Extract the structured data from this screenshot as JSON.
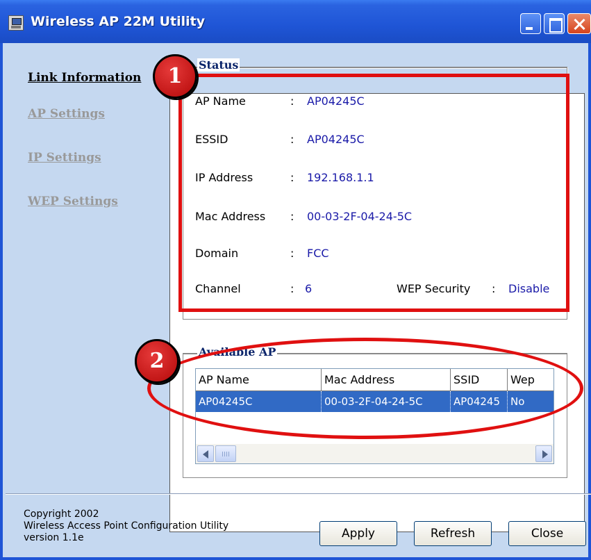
{
  "window": {
    "title": "Wireless AP 22M Utility",
    "icon": "app-window-icon"
  },
  "sidebar": {
    "items": [
      {
        "label": "Link Information",
        "active": true
      },
      {
        "label": "AP Settings",
        "active": false
      },
      {
        "label": "IP Settings",
        "active": false
      },
      {
        "label": "WEP Settings",
        "active": false
      }
    ]
  },
  "status": {
    "title": "Status",
    "fields": [
      {
        "label": "AP Name",
        "sep": ":",
        "value": "AP04245C"
      },
      {
        "label": "ESSID",
        "sep": ":",
        "value": "AP04245C"
      },
      {
        "label": "IP Address",
        "sep": ":",
        "value": "192.168.1.1"
      },
      {
        "label": "Mac Address",
        "sep": ":",
        "value": "00-03-2F-04-24-5C"
      },
      {
        "label": "Domain",
        "sep": ":",
        "value": "FCC"
      },
      {
        "label": "Channel",
        "sep": ":",
        "value": "6"
      }
    ],
    "wep": {
      "label": "WEP Security",
      "sep": ":",
      "value": "Disable"
    }
  },
  "available_ap": {
    "title": "Available AP",
    "columns": [
      "AP Name",
      "Mac Address",
      "SSID",
      "Wep"
    ],
    "rows": [
      [
        "AP04245C",
        "00-03-2F-04-24-5C",
        "AP04245",
        "No"
      ]
    ]
  },
  "footer": {
    "copyright_lines": [
      "Copyright 2002",
      "Wireless Access Point Configuration Utility",
      "version 1.1e"
    ],
    "buttons": {
      "apply": "Apply",
      "refresh": "Refresh",
      "close": "Close"
    }
  },
  "annotations": {
    "badge1": "1",
    "badge2": "2",
    "color": "#e01010"
  },
  "colors": {
    "titlebar": "#1f55d6",
    "client_bg": "#c5d8f0",
    "value_text": "#1a1aa8",
    "selection": "#316ac5"
  }
}
